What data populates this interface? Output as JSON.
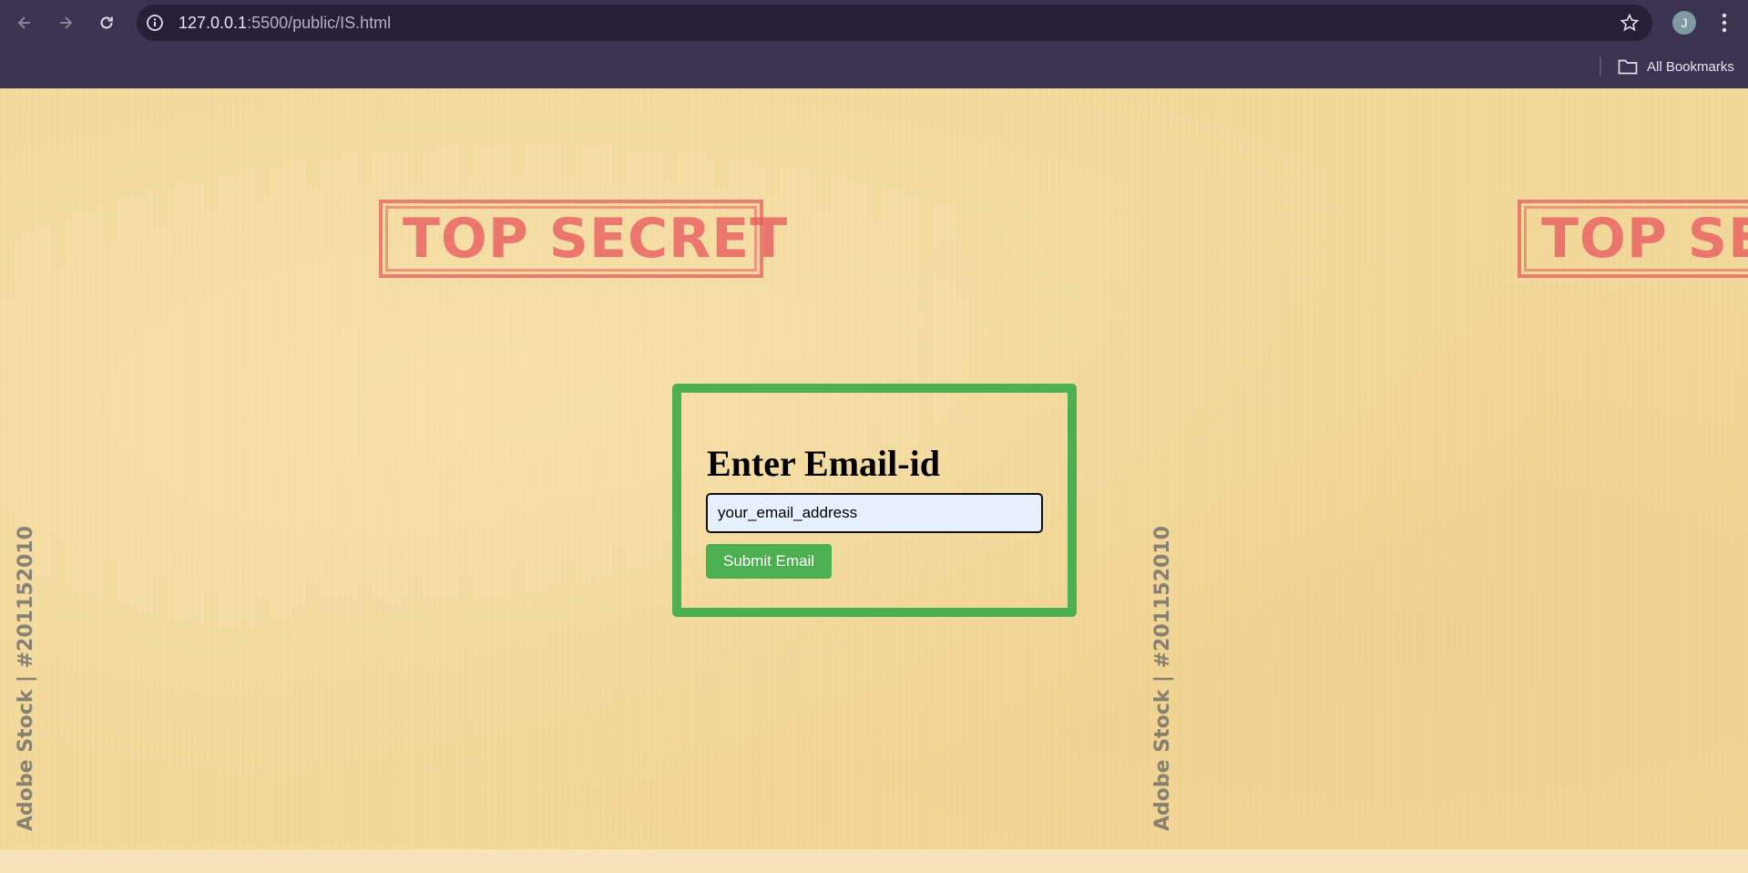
{
  "browser": {
    "url_host": "127.0.0.1",
    "url_path": ":5500/public/IS.html",
    "profile_initial": "J",
    "bookmarks_label": "All Bookmarks",
    "icons": [
      "back-icon",
      "forward-icon",
      "reload-icon",
      "info-icon",
      "star-icon",
      "kebab-menu-icon",
      "folder-icon"
    ]
  },
  "background": {
    "stamp_text": "TOP SECRET",
    "stamp_text_partial": "TOP SEC",
    "watermark_text": "Adobe Stock | #201152010",
    "stamp_color": "#e85a5f"
  },
  "form": {
    "heading": "Enter Email-id",
    "email_value": "your_email_address",
    "submit_label": "Submit Email",
    "accent_color": "#4caf50"
  }
}
